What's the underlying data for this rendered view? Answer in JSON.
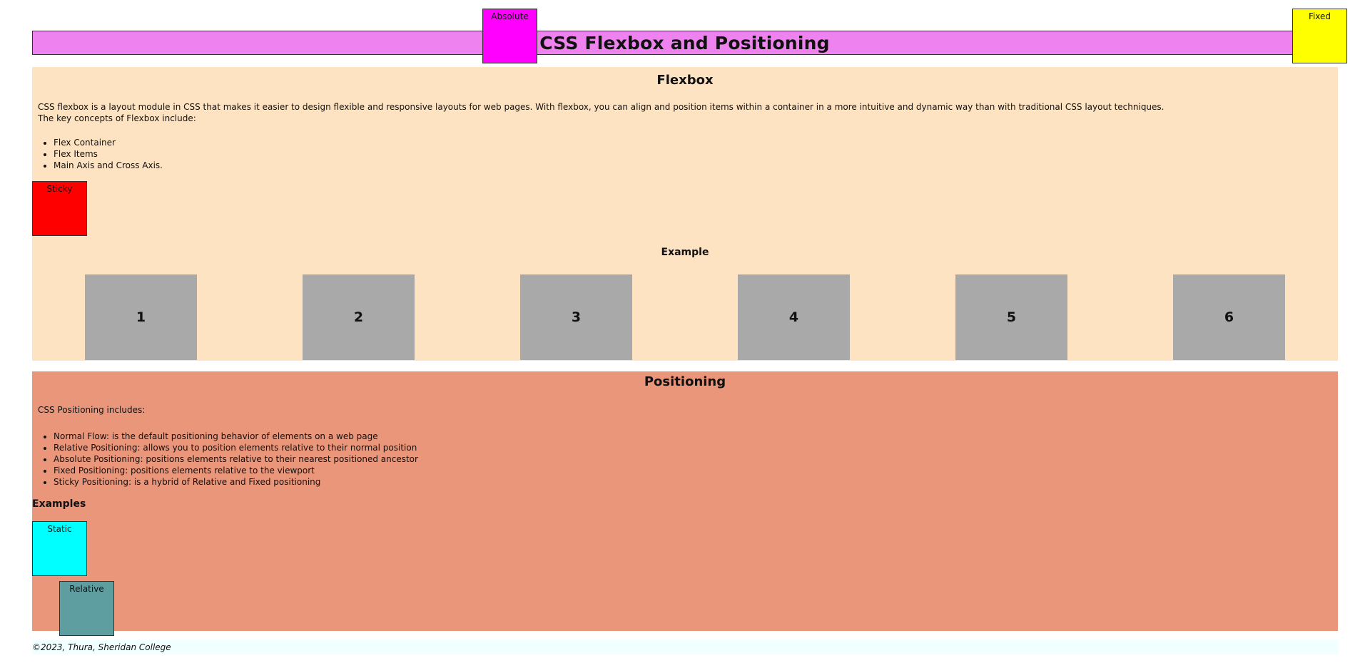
{
  "header": {
    "title": "CSS Flexbox and Positioning",
    "absolute_label": "Absolute",
    "fixed_label": "Fixed"
  },
  "flexbox": {
    "title": "Flexbox",
    "intro_line1": "CSS flexbox is a layout module in CSS that makes it easier to design flexible and responsive layouts for web pages. With flexbox, you can align and position items within a container in a more intuitive and dynamic way than with traditional CSS layout techniques.",
    "intro_line2": "The key concepts of Flexbox include:",
    "concepts": [
      "Flex Container",
      "Flex Items",
      "Main Axis and Cross Axis."
    ],
    "sticky_label": "Sticky",
    "example_label": "Example",
    "items": [
      "1",
      "2",
      "3",
      "4",
      "5",
      "6"
    ]
  },
  "positioning": {
    "title": "Positioning",
    "intro": "CSS Positioning includes:",
    "list": [
      "Normal Flow: is the default positioning behavior of elements on a web page",
      "Relative Positioning: allows you to position elements relative to their normal position",
      "Absolute Positioning: positions elements relative to their nearest positioned ancestor",
      "Fixed Positioning: positions elements relative to the viewport",
      "Sticky Positioning: is a hybrid of Relative and Fixed positioning"
    ],
    "examples_heading": "Examples",
    "static_label": "Static",
    "relative_label": "Relative"
  },
  "footer": {
    "text": "©2023, Thura, Sheridan College"
  },
  "colors": {
    "header_bg": "#ee82ee",
    "absolute_box": "#ff00ff",
    "fixed_box": "#ffff00",
    "flexbox_bg": "#fde3c2",
    "sticky_box": "#ff0000",
    "flex_item_bg": "#a9a9a9",
    "positioning_bg": "#e9967a",
    "static_box": "#00ffff",
    "relative_box": "#5f9ea0",
    "footer_bg": "#f0ffff"
  }
}
